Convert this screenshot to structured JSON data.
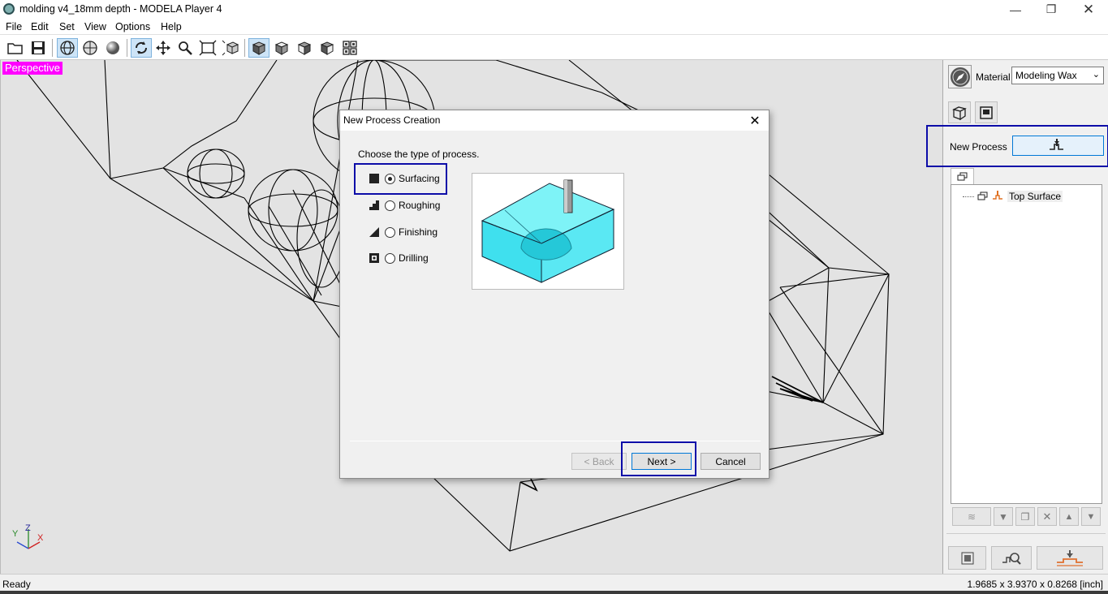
{
  "window": {
    "title": "molding v4_18mm depth  - MODELA Player 4"
  },
  "menu": [
    "File",
    "Edit",
    "Set",
    "View",
    "Options",
    "Help"
  ],
  "toolbar": {
    "icons": [
      "open-folder-icon",
      "save-icon",
      "wireframe-view-icon",
      "surface-view-icon",
      "solid-view-icon",
      "rotate-icon",
      "pan-icon",
      "zoom-icon",
      "fit-icon",
      "zoom-box-icon",
      "front-view-icon",
      "top-view-icon",
      "right-view-icon",
      "iso-view-icon",
      "four-views-icon"
    ]
  },
  "viewport": {
    "mode_label": "Perspective",
    "axes": {
      "z": "Z",
      "y": "Y",
      "x": "X"
    }
  },
  "right_panel": {
    "material_label": "Material",
    "material_value": "Modeling Wax",
    "new_process_label": "New Process",
    "tree": [
      {
        "label": "Top Surface"
      }
    ]
  },
  "dialog": {
    "title": "New Process Creation",
    "prompt": "Choose the type of process.",
    "options": [
      {
        "label": "Surfacing",
        "checked": true
      },
      {
        "label": "Roughing",
        "checked": false
      },
      {
        "label": "Finishing",
        "checked": false
      },
      {
        "label": "Drilling",
        "checked": false
      }
    ],
    "buttons": {
      "back": "< Back",
      "next": "Next >",
      "cancel": "Cancel"
    }
  },
  "status": {
    "left": "Ready",
    "right": "1.9685 x 3.9370 x 0.8268 [inch]"
  },
  "colors": {
    "highlight": "#0c0ca8",
    "perspective_bg": "#ff00ff",
    "preview_block": "#40e0f0"
  }
}
